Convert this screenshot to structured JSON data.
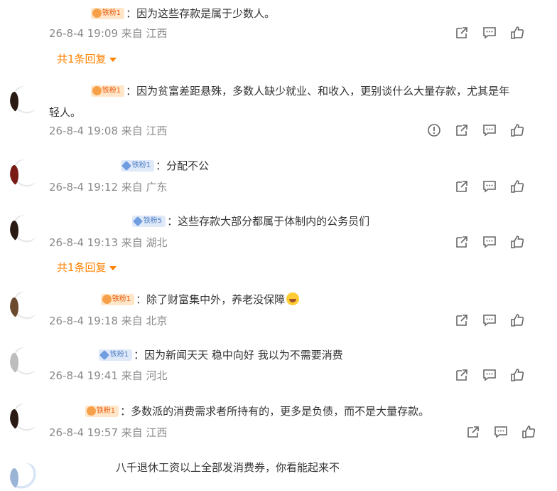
{
  "comments": [
    {
      "badge": "铁粉1",
      "badge_style": "gold",
      "text": "：因为这些存款是属于少数人。",
      "date": "26-8-4 19:09",
      "source": "来自 江西",
      "replies": "共1条回复",
      "avatar": "none"
    },
    {
      "badge": "铁粉1",
      "badge_style": "gold",
      "text": "：因为贫富差距悬殊，多数人缺少就业、和收入，更别谈什么大量存款，尤其是年",
      "text2": "轻人。",
      "date": "26-8-4 19:08",
      "source": "来自 江西",
      "avatar": "dark"
    },
    {
      "badge": "铁粉1",
      "badge_style": "blue",
      "text": "：分配不公",
      "date": "26-8-4 19:12",
      "source": "来自 广东",
      "avatar": "red"
    },
    {
      "badge": "铁粉5",
      "badge_style": "blue",
      "text": "：这些存款大部分都属于体制内的公务员们",
      "date": "26-8-4 19:13",
      "source": "来自 湖北",
      "replies": "共1条回复",
      "avatar": "dark"
    },
    {
      "badge": "铁粉1",
      "badge_style": "gold",
      "text": "：除了财富集中外，养老没保障",
      "date": "26-8-4 19:18",
      "source": "来自 北京",
      "avatar": "brown"
    },
    {
      "badge": "铁粉1",
      "badge_style": "blue",
      "text": "：因为新闻天天 稳中向好 我以为不需要消费",
      "date": "26-8-4 19:41",
      "source": "来自 河北",
      "avatar": "light"
    },
    {
      "badge": "铁粉1",
      "badge_style": "gold",
      "text": "：多数派的消费需求者所持有的，更多是负债，而不是大量存款。",
      "date": "26-8-4 19:57",
      "source": "来自 江西",
      "avatar": "dark"
    },
    {
      "text": "八千退休工资以上全部发消费券，你看能起来不",
      "avatar": "blue"
    }
  ]
}
